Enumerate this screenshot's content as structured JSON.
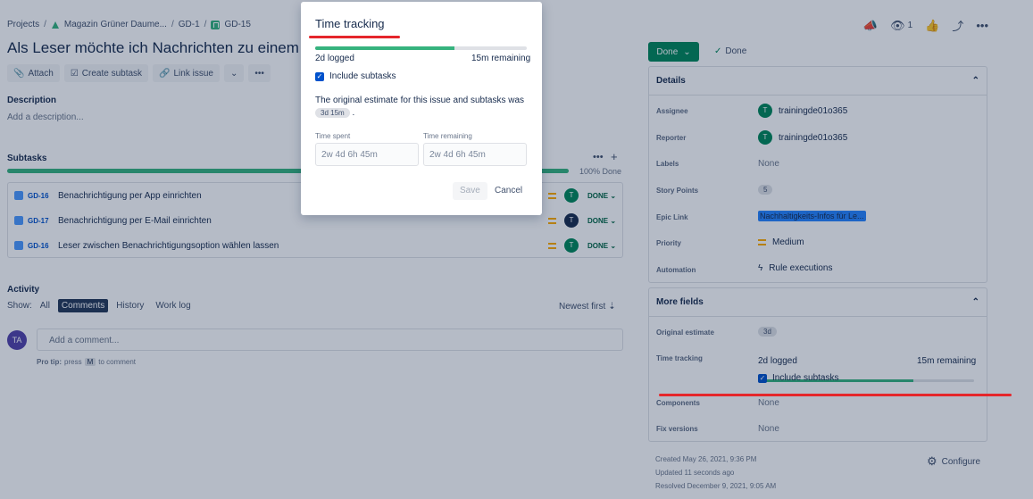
{
  "breadcrumb": {
    "projects": "Projects",
    "sep": "/",
    "project": "Magazin Grüner Daume...",
    "epic": "GD-1",
    "issue": "GD-15"
  },
  "top_actions": {
    "watch_count": "1"
  },
  "issue": {
    "title": "Als Leser möchte ich Nachrichten zu einem bestimmten Thema"
  },
  "toolbar": {
    "attach": "Attach",
    "create_subtask": "Create subtask",
    "link_issue": "Link issue"
  },
  "description": {
    "heading": "Description",
    "placeholder": "Add a description..."
  },
  "subtasks": {
    "heading": "Subtasks",
    "progress_label": "100% Done",
    "progress_fraction": 1.0,
    "items": [
      {
        "key": "GD-16",
        "summary": "Benachrichtigung per App einrichten",
        "assignee": "T",
        "status": "DONE"
      },
      {
        "key": "GD-17",
        "summary": "Benachrichtigung per E-Mail einrichten",
        "assignee": "T",
        "status": "DONE"
      },
      {
        "key": "GD-16",
        "summary": "Leser zwischen Benachrichtigungsoption wählen lassen",
        "assignee": "T",
        "status": "DONE"
      }
    ]
  },
  "activity": {
    "heading": "Activity",
    "show_label": "Show:",
    "filters": [
      "All",
      "Comments",
      "History",
      "Work log"
    ],
    "active_filter": "Comments",
    "sort": "Newest first",
    "user_initials": "TA",
    "comment_placeholder": "Add a comment...",
    "protip_bold": "Pro tip:",
    "protip_press": "press",
    "protip_key": "M",
    "protip_rest": "to comment"
  },
  "status": {
    "button": "Done",
    "resolution": "Done"
  },
  "details": {
    "heading": "Details",
    "fields": {
      "assignee_label": "Assignee",
      "assignee": "trainingde01o365",
      "reporter_label": "Reporter",
      "reporter": "trainingde01o365",
      "labels_label": "Labels",
      "labels": "None",
      "story_points_label": "Story Points",
      "story_points": "5",
      "epic_link_label": "Epic Link",
      "epic_link": "Nachhaltigkeits-Infos für Le...",
      "priority_label": "Priority",
      "priority": "Medium",
      "automation_label": "Automation",
      "automation": "Rule executions"
    }
  },
  "more_fields": {
    "heading": "More fields",
    "original_estimate_label": "Original estimate",
    "original_estimate": "3d",
    "time_tracking_label": "Time tracking",
    "logged": "2d logged",
    "remaining": "15m remaining",
    "progress_fraction": 0.72,
    "include_subtasks": "Include subtasks",
    "components_label": "Components",
    "components": "None",
    "fix_versions_label": "Fix versions",
    "fix_versions": "None"
  },
  "footer_meta": {
    "created": "Created May 26, 2021, 9:36 PM",
    "updated": "Updated 11 seconds ago",
    "resolved": "Resolved December 9, 2021, 9:05 AM",
    "configure": "Configure"
  },
  "modal": {
    "title": "Time tracking",
    "logged": "2d logged",
    "remaining": "15m remaining",
    "progress_fraction": 0.66,
    "include_subtasks": "Include subtasks",
    "estimate_text": "The original estimate for this issue and subtasks was",
    "estimate_value": "3d 15m",
    "time_spent_label": "Time spent",
    "time_spent_placeholder": "2w 4d 6h 45m",
    "time_remaining_label": "Time remaining",
    "time_remaining_placeholder": "2w 4d 6h 45m",
    "save": "Save",
    "cancel": "Cancel"
  },
  "colors": {
    "brand_blue": "#0052cc",
    "done_green": "#00875a",
    "progress_green": "#36b37e",
    "annotation_red": "#e5262b",
    "status_button": "#00875a"
  }
}
